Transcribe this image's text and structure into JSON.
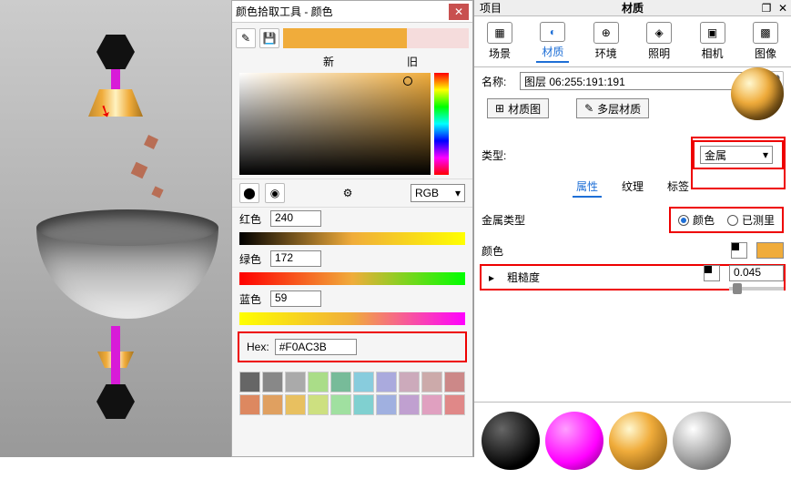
{
  "color_panel": {
    "title": "颜色拾取工具 - 颜色",
    "new_label": "新",
    "old_label": "旧",
    "mode": "RGB",
    "sliders": {
      "red": {
        "label": "红色",
        "value": "240"
      },
      "green": {
        "label": "绿色",
        "value": "172"
      },
      "blue": {
        "label": "蓝色",
        "value": "59"
      }
    },
    "hex_label": "Hex:",
    "hex_value": "#F0AC3B",
    "swatch_colors": [
      "#666",
      "#888",
      "#aaa",
      "#ad8",
      "#7b9",
      "#8cd",
      "#aad",
      "#cab",
      "#caa",
      "#c88",
      "#dd8860",
      "#e0a060",
      "#e8c060",
      "#cde080",
      "#a0e0a0",
      "#80d0d0",
      "#a0b0e0",
      "#c0a0d0",
      "#e0a0c0",
      "#e08888"
    ]
  },
  "right": {
    "project_label": "项目",
    "header_title": "材质",
    "tabs": {
      "scene": "场景",
      "material": "材质",
      "environment": "环境",
      "lighting": "照明",
      "camera": "相机",
      "image": "图像"
    },
    "name_label": "名称:",
    "name_value": "图层 06:255:191:191",
    "material_map_label": "材质图",
    "multilayer_label": "多层材质",
    "type_label": "类型:",
    "type_value": "金属",
    "subtabs": {
      "props": "属性",
      "texture": "纹理",
      "label": "标签"
    },
    "metal_type_label": "金属类型",
    "radio_color": "颜色",
    "radio_measured": "已测里",
    "color_label": "颜色",
    "rough_label": "粗糙度",
    "rough_value": "0.045"
  }
}
